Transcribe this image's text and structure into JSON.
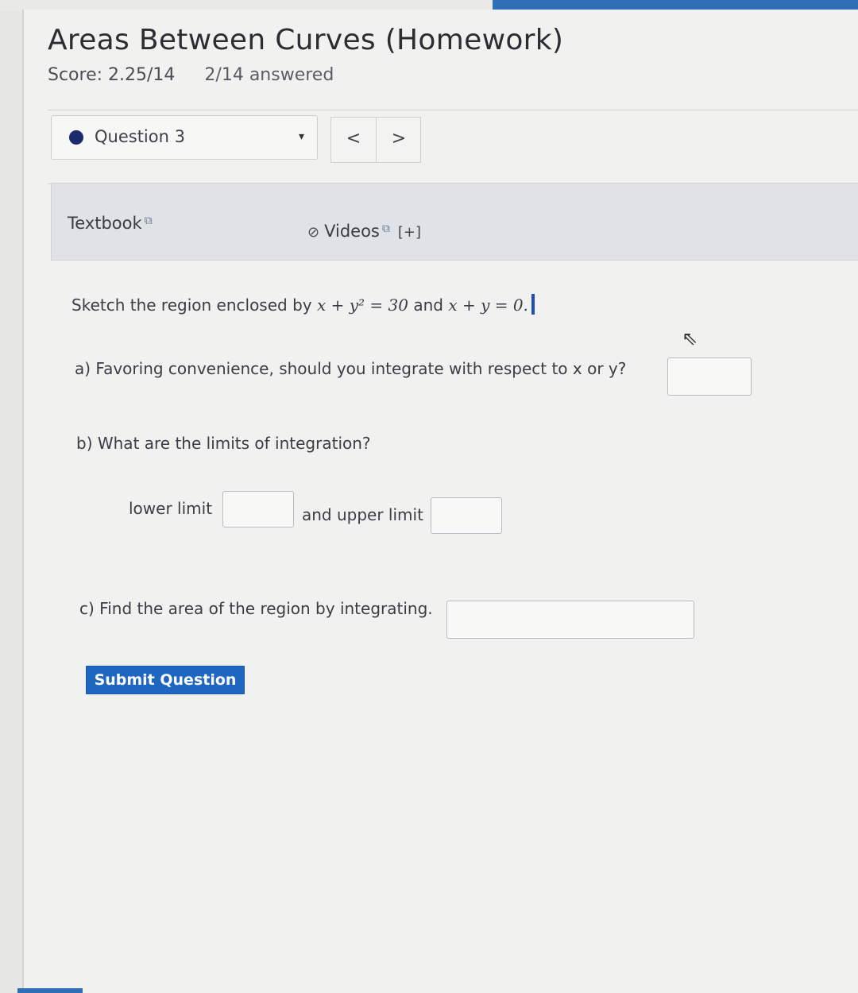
{
  "header": {
    "title": "Areas Between Curves (Homework)",
    "score": "Score: 2.25/14",
    "answered": "2/14 answered"
  },
  "question_nav": {
    "selected": "Question 3",
    "caret": "▾",
    "prev": "<",
    "next": ">"
  },
  "resources": {
    "textbook": "Textbook",
    "videos": "Videos",
    "expand": "[+]"
  },
  "problem": {
    "prompt_prefix": "Sketch the region enclosed by ",
    "eq1": "x + y² = 30",
    "connector": " and ",
    "eq2": "x + y = 0.",
    "part_a": "a) Favoring convenience, should you integrate with respect to x or y?",
    "part_b": "b) What are the limits of integration?",
    "lower_label": "lower limit",
    "upper_label": "and upper limit",
    "part_c": "c) Find the area of the region by integrating."
  },
  "answers": {
    "part_a": "",
    "lower_limit": "",
    "upper_limit": "",
    "area": ""
  },
  "actions": {
    "submit": "Submit Question"
  },
  "colors": {
    "accent": "#1f66c1",
    "question_dot": "#1a2a6c"
  }
}
